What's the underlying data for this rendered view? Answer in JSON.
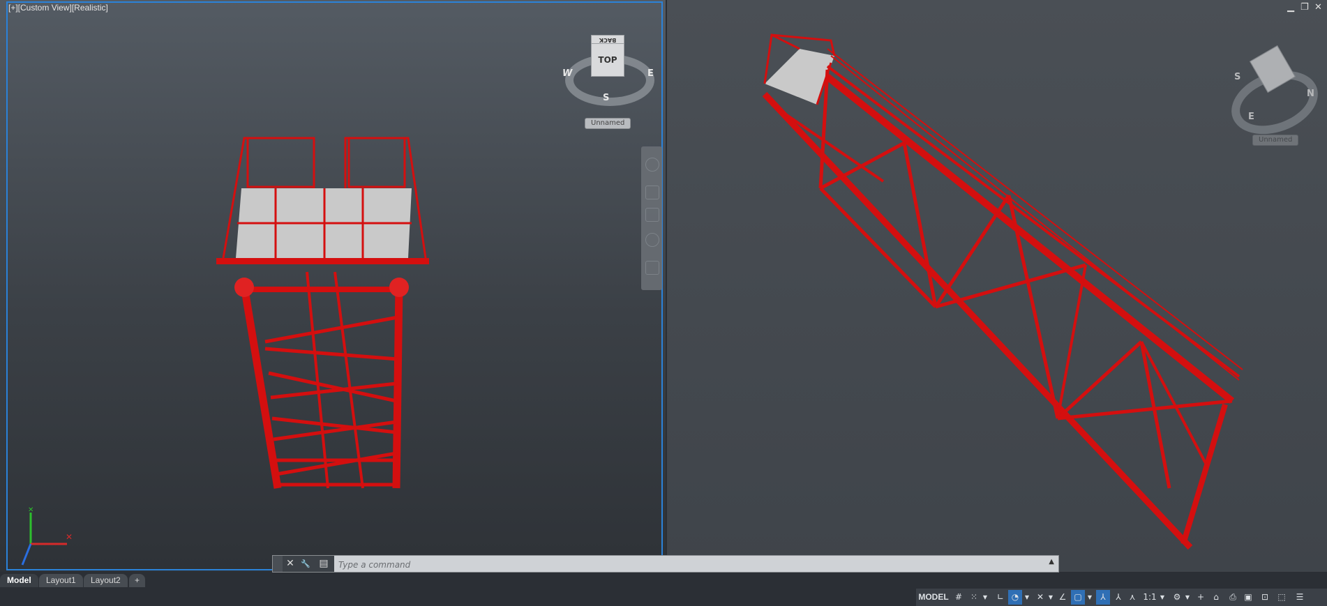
{
  "viewports": {
    "left": {
      "label": "[+][Custom View][Realistic]",
      "viewcube": {
        "top_face": "TOP",
        "back_face": "BACK",
        "dir_w": "W",
        "dir_e": "E",
        "dir_s": "S",
        "named_view": "Unnamed"
      }
    },
    "right": {
      "window_controls": {
        "minimize": "▁",
        "restore": "❐",
        "close": "✕"
      },
      "viewcube": {
        "dir_s": "S",
        "dir_n": "N",
        "dir_e": "E",
        "named_view": "Unnamed"
      }
    }
  },
  "command_line": {
    "placeholder": "Type a command",
    "close_icon": "✕",
    "customize_icon": "🔧",
    "recent_icon": "▤",
    "expand_icon": "▲"
  },
  "tabs": {
    "items": [
      {
        "label": "Model"
      },
      {
        "label": "Layout1"
      },
      {
        "label": "Layout2"
      }
    ],
    "add_label": "+"
  },
  "statusbar": {
    "model_label": "MODEL",
    "scale_label": "1:1"
  },
  "colors": {
    "structure": "#d40f0f",
    "grating": "#c9c9c9",
    "active_border": "#2b82d9"
  }
}
